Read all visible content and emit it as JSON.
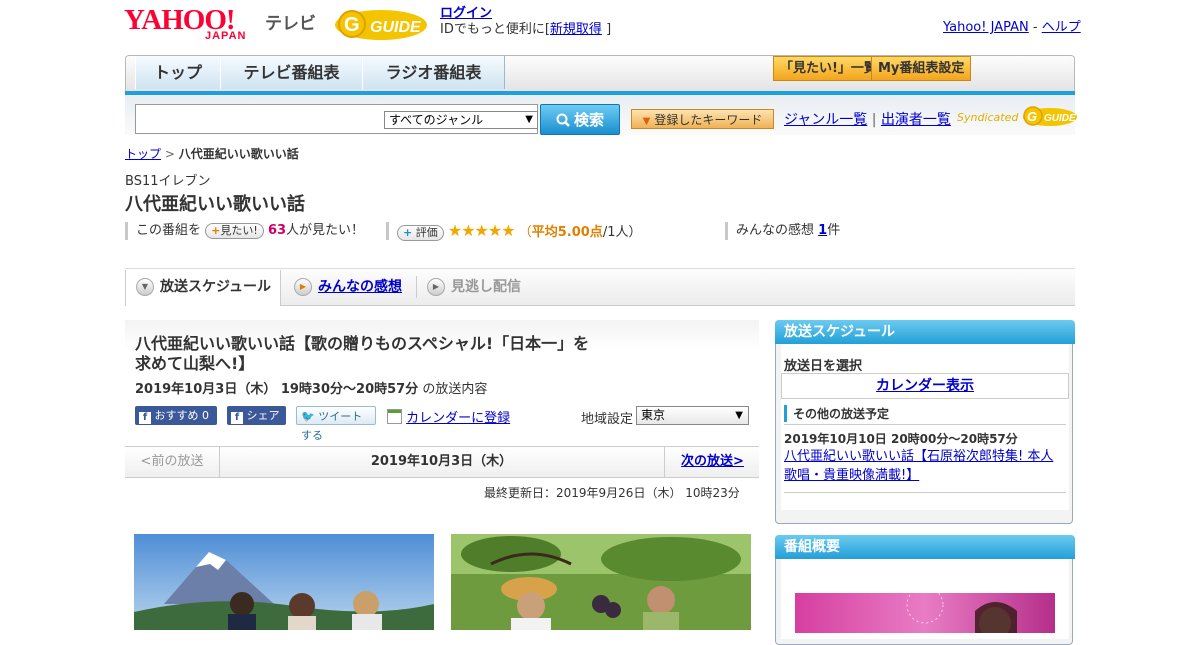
{
  "header": {
    "logo_text": "YAHOO!",
    "logo_sub": "JAPAN",
    "service_name": "テレビ",
    "guide_logo": "G GUIDE",
    "login_label": "ログイン",
    "login_desc_prefix": "IDでもっと便利に[",
    "register_label": "新規取得",
    "login_desc_suffix": "]",
    "yahoo_japan_link": "Yahoo! JAPAN",
    "separator": "-",
    "help_link": "ヘルプ"
  },
  "nav": {
    "tabs": [
      "トップ",
      "テレビ番組表",
      "ラジオ番組表"
    ],
    "want_list_button": "「見たい!」一覧",
    "my_schedule_button": "My番組表設定"
  },
  "search": {
    "placeholder": "",
    "genre_selected": "すべてのジャンル",
    "search_button": "検索",
    "keyword_button": "登録したキーワード",
    "genre_list_link": "ジャンル一覧",
    "divider": "|",
    "cast_list_link": "出演者一覧",
    "syndicated_label": "Syndicated"
  },
  "breadcrumb": {
    "top_link": "トップ",
    "separator": ">",
    "current": "八代亜紀いい歌いい話"
  },
  "program": {
    "channel": "BS11イレブン",
    "title": "八代亜紀いい歌いい話",
    "want_prefix": "この番組を",
    "want_pill": "見たい!",
    "want_count": "63",
    "want_suffix": "人が見たい！",
    "rating_pill": "評価",
    "stars": "★★★★★",
    "rating_open": "（",
    "rating_avg": "平均5.00点",
    "rating_people": "/1人）",
    "review_prefix": "みんなの感想",
    "review_count": "1",
    "review_suffix": "件"
  },
  "tabs": {
    "schedule": "放送スケジュール",
    "reviews": "みんなの感想",
    "missed": "見逃し配信"
  },
  "episode": {
    "title_line1": "八代亜紀いい歌いい話【歌の贈りものスペシャル!「日本一」を",
    "title_line2": "求めて山梨へ!】",
    "date_time": "2019年10月3日（木）  19時30分～20時57分",
    "date_suffix": "の放送内容",
    "recommend_label": "おすすめ",
    "recommend_count": "0",
    "share_label": "シェア",
    "tweet_label": "ツイートする",
    "calendar_register": "カレンダーに登録",
    "region_label": "地域設定",
    "region_selected": "東京",
    "prev_broadcast": "<前の放送",
    "current_date": "2019年10月3日（木）",
    "next_broadcast": "次の放送>",
    "last_updated": "最終更新日：2019年9月26日（木）  10時23分"
  },
  "sidebar": {
    "schedule_header": "放送スケジュール",
    "select_date": "放送日を選択",
    "calendar_button": "カレンダー表示",
    "other_schedule": "その他の放送予定",
    "other_date": "2019年10月10日  20時00分～20時57分",
    "other_title": "八代亜紀いい歌いい話【石原裕次郎特集! 本人歌唱・貴重映像満載!】",
    "overview_header": "番組概要"
  },
  "colors": {
    "accent_blue": "#22a0d8",
    "yahoo_red": "#ff0033",
    "star_orange": "#f0a800",
    "link_blue": "#0000cc"
  }
}
